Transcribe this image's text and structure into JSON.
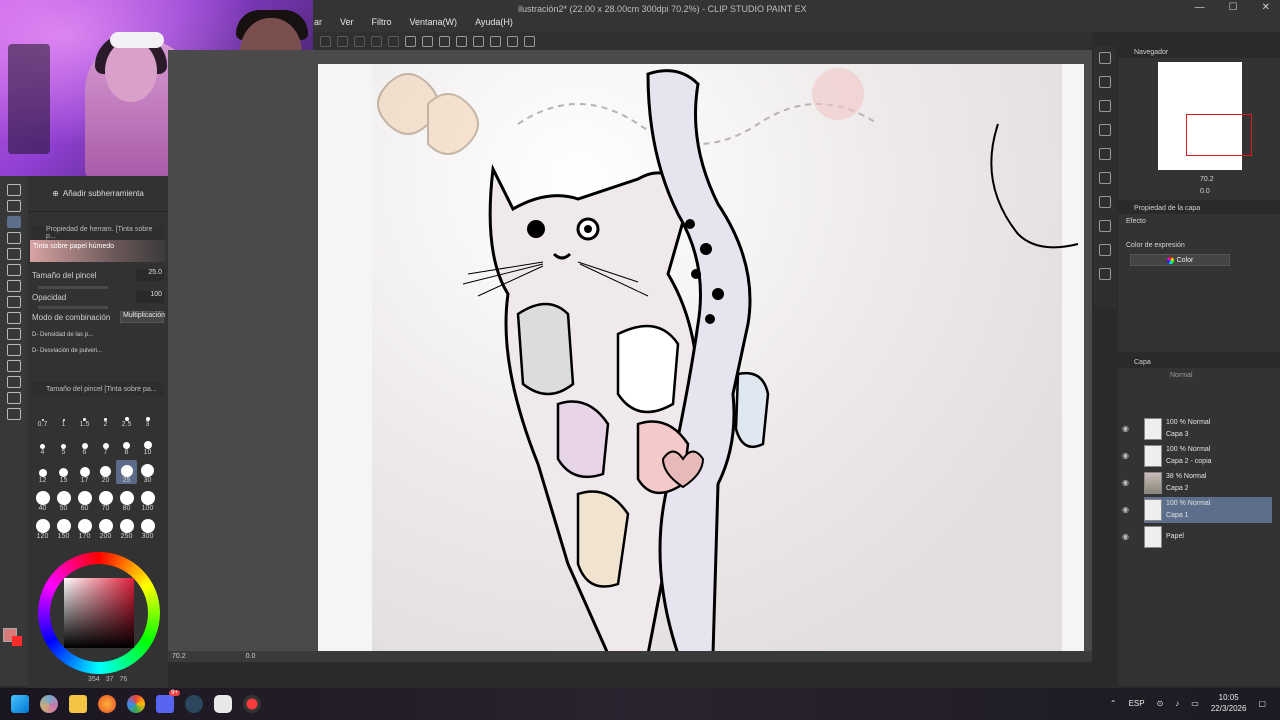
{
  "app": {
    "title": "ilustración2* (22.00 x 28.00cm 300dpi 70.2%) - CLIP STUDIO PAINT EX",
    "menu": [
      "ar",
      "Ver",
      "Filtro",
      "Ventana(W)",
      "Ayuda(H)"
    ]
  },
  "subtool": {
    "add_label": "Añadir subherramienta",
    "prop_title": "Propiedad de herram. [Tinta sobre p...",
    "preset_name": "Tinta sobre papel húmedo",
    "brush_size_label": "Tamaño del pincel",
    "brush_size_value": "25.0",
    "opacity_label": "Opacidad",
    "opacity_value": "100",
    "blend_label": "Modo de combinación",
    "blend_value": "Multiplicación",
    "density_label": "D- Densidad de las p...",
    "spread_label": "D- Desviación de pulveri...",
    "sizes_title": "Tamaño del pincel [Tinta sobre pa...",
    "sizes": [
      "0.7",
      "1",
      "1.5",
      "2",
      "2.5",
      "3",
      "4",
      "5",
      "6",
      "7",
      "8",
      "10",
      "12",
      "15",
      "17",
      "20",
      "25",
      "30",
      "40",
      "50",
      "60",
      "70",
      "80",
      "100",
      "120",
      "150",
      "170",
      "200",
      "250",
      "300"
    ],
    "selected_size": "25"
  },
  "color": {
    "main": "#d67a7a",
    "sub": "#ff2a2a",
    "status": [
      "354",
      "37",
      "76"
    ]
  },
  "canvas": {
    "zoom": "70.2",
    "angle": "0.0"
  },
  "navigator": {
    "title": "Navegador",
    "zoom": "70.2",
    "angle": "0.0"
  },
  "layer_property": {
    "title": "Propiedad de la capa",
    "effect_label": "Efecto",
    "expr_color_label": "Color de expresión",
    "expr_color_value": "Color"
  },
  "layers": {
    "title": "Capa",
    "blend": "Normal",
    "items": [
      {
        "mode": "100 % Normal",
        "name": "Capa 3"
      },
      {
        "mode": "100 % Normal",
        "name": "Capa 2 - copia"
      },
      {
        "mode": "38 % Normal",
        "name": "Capa 2"
      },
      {
        "mode": "100 % Normal",
        "name": "Capa 1"
      },
      {
        "mode": "",
        "name": "Papel"
      }
    ],
    "selected_index": 3
  },
  "taskbar": {
    "lang": "ESP",
    "time": "10:05",
    "date": "22/3/2026",
    "discord_badge": "9+"
  }
}
